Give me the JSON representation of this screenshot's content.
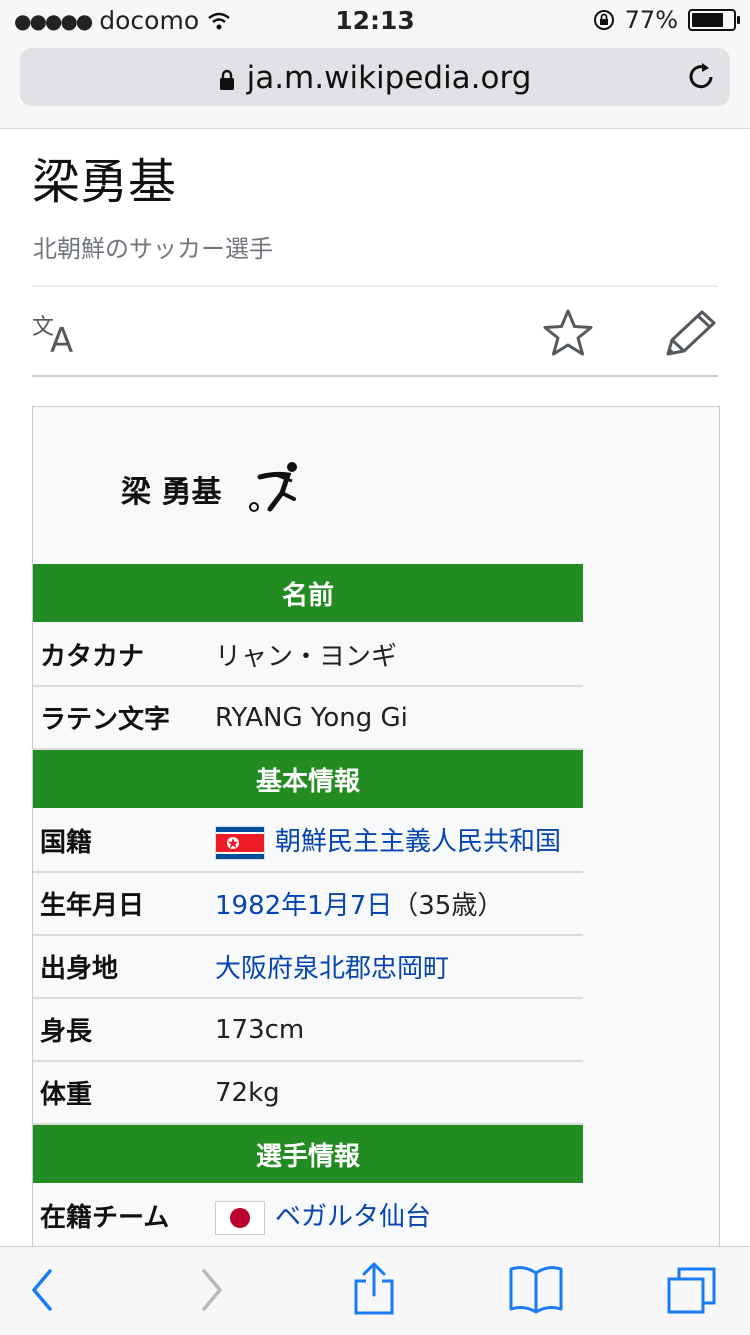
{
  "status_bar": {
    "carrier": "docomo",
    "time": "12:13",
    "battery": "77%",
    "battery_level": 0.77
  },
  "browser": {
    "url": "ja.m.wikipedia.org"
  },
  "page": {
    "title": "梁勇基",
    "subtitle": "北朝鮮のサッカー選手"
  },
  "infobox": {
    "heading": "梁 勇基",
    "rows": [
      {
        "type": "section",
        "label": "名前"
      },
      {
        "type": "row",
        "label": "カタカナ",
        "value": "リャン・ヨンギ"
      },
      {
        "type": "row",
        "label": "ラテン文字",
        "value": "RYANG Yong Gi"
      },
      {
        "type": "section",
        "label": "基本情報"
      },
      {
        "type": "row",
        "label": "国籍",
        "value": "朝鮮民主主義人民共和国",
        "flag": "north-korea-flag"
      },
      {
        "type": "row",
        "label": "生年月日",
        "value": "1982年1月7日",
        "suffix": "（35歳）"
      },
      {
        "type": "row",
        "label": "出身地",
        "value": "大阪府泉北郡忠岡町"
      },
      {
        "type": "row",
        "label": "身長",
        "value": "173cm"
      },
      {
        "type": "row",
        "label": "体重",
        "value": "72kg"
      },
      {
        "type": "section",
        "label": "選手情報"
      },
      {
        "type": "row",
        "label": "在籍チーム",
        "value": "ベガルタ仙台",
        "flag": "japan-flag"
      }
    ]
  },
  "colors": {
    "section_green": "#228b22",
    "link_blue": "#0645ad",
    "ios_blue": "#1a7cf5"
  }
}
